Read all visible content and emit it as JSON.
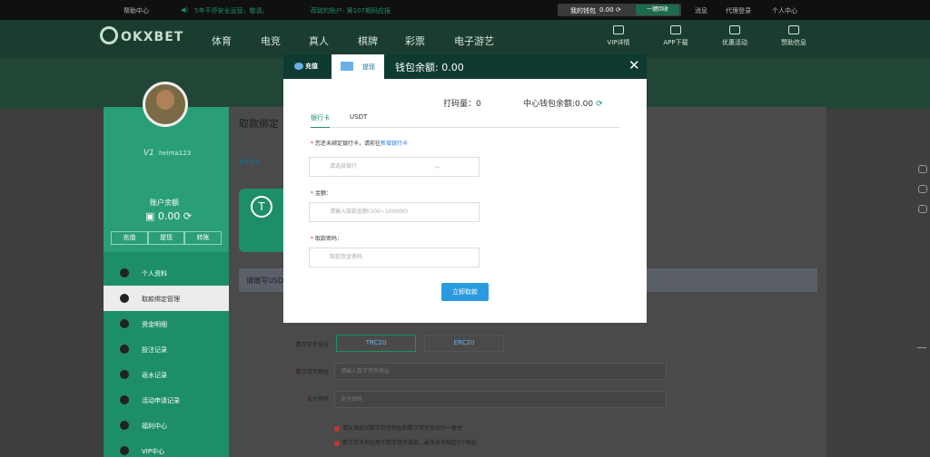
{
  "topbar": {
    "help": "帮助中心",
    "notice": "5年不停安全运营，敬请。",
    "recommend": "荐敌的账户: 第107期码应报",
    "wallet_label": "我的钱包",
    "wallet_value": "0.00",
    "refresh_btn": "一键回收",
    "messages": "消息",
    "agent_login": "代理登录",
    "profile": "个人中心"
  },
  "header": {
    "logo_text": "OKXBET",
    "nav": [
      "体育",
      "电竞",
      "真人",
      "棋牌",
      "彩票",
      "电子游艺"
    ],
    "right_nav": [
      "VIP详情",
      "APP下载",
      "优惠活动",
      "赞助信息"
    ]
  },
  "sidebar": {
    "vip": "V1",
    "username": "heima123",
    "balance_label": "账户余额",
    "balance": "0.00",
    "buttons": [
      "充值",
      "提现",
      "转账"
    ],
    "menu": [
      "个人资料",
      "取款绑定管理",
      "资金明细",
      "投注记录",
      "返水记录",
      "活动申请记录",
      "福利中心",
      "VIP中心"
    ],
    "active_index": 1
  },
  "main": {
    "title": "取款绑定",
    "tab": "数字货币",
    "form_head": "请填写USD",
    "protocol_label": "数字货币协议",
    "protocols": [
      "TRC20",
      "ERC20"
    ],
    "address_label": "数字货币地址",
    "address_placeholder": "请输入数字货币地址",
    "paypwd_label": "支付密码",
    "paypwd_placeholder": "支付密码",
    "notes": [
      "请认真校对数字货币地址和数字货币协议的一致性",
      "数字货币地址用于数字货币提款。最多支持绑定5个地址"
    ]
  },
  "modal": {
    "tab_deposit": "充值",
    "tab_withdraw": "提现",
    "wallet_label": "钱包余额:",
    "wallet_value": "0.00",
    "close": "✕",
    "code_label": "打码量：",
    "code_value": "0",
    "center_label": "中心钱包余额:",
    "center_value": "0.00",
    "tabs": [
      "银行卡",
      "USDT"
    ],
    "bank_prompt": "您还未绑定银行卡，请前往",
    "bank_link": "新增银行卡",
    "bank_placeholder": "请选择银行",
    "amount_label": "金额：",
    "amount_placeholder": "请输入取款金额(100~100000)",
    "pwd_label": "取款密码：",
    "pwd_placeholder": "取款资金密码",
    "submit": "立即取款"
  }
}
